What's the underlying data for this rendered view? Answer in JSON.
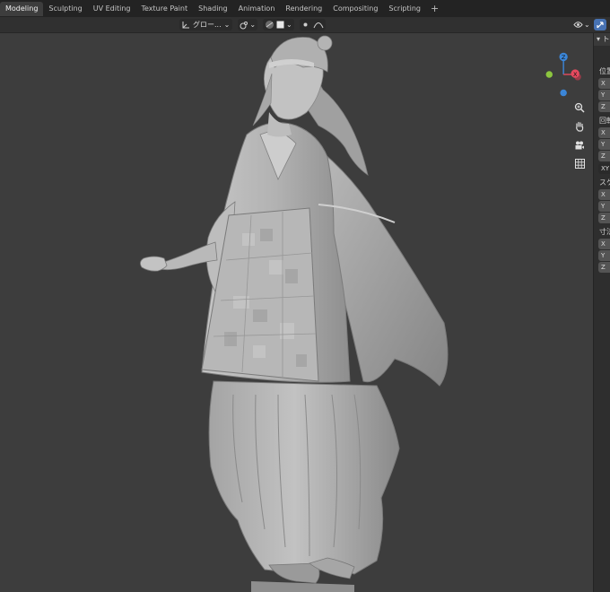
{
  "workspace_tabs": [
    "Modeling",
    "Sculpting",
    "UV Editing",
    "Texture Paint",
    "Shading",
    "Animation",
    "Rendering",
    "Compositing",
    "Scripting"
  ],
  "active_tab": "Modeling",
  "add_tab_label": "+",
  "header": {
    "transform_orientation": "グロー...",
    "chevron": "⌄"
  },
  "npanel": {
    "header_label": "ト",
    "location_label": "位置",
    "rotation_label": "回転",
    "scale_label": "スケ",
    "dimensions_label": "寸法",
    "rotation_mode": "XY",
    "axes": [
      "X",
      "Y",
      "Z"
    ]
  },
  "gizmo": {
    "z_label": "Z",
    "x_label": "X",
    "colors": {
      "x": "#e84a5f",
      "y": "#8cc63f",
      "z": "#3b86d8",
      "x_neg": "#9b3a48"
    }
  },
  "colors": {
    "viewport_bg": "#3d3d3d",
    "accent": "#4772b3",
    "mesh": "#a9a9a9"
  }
}
